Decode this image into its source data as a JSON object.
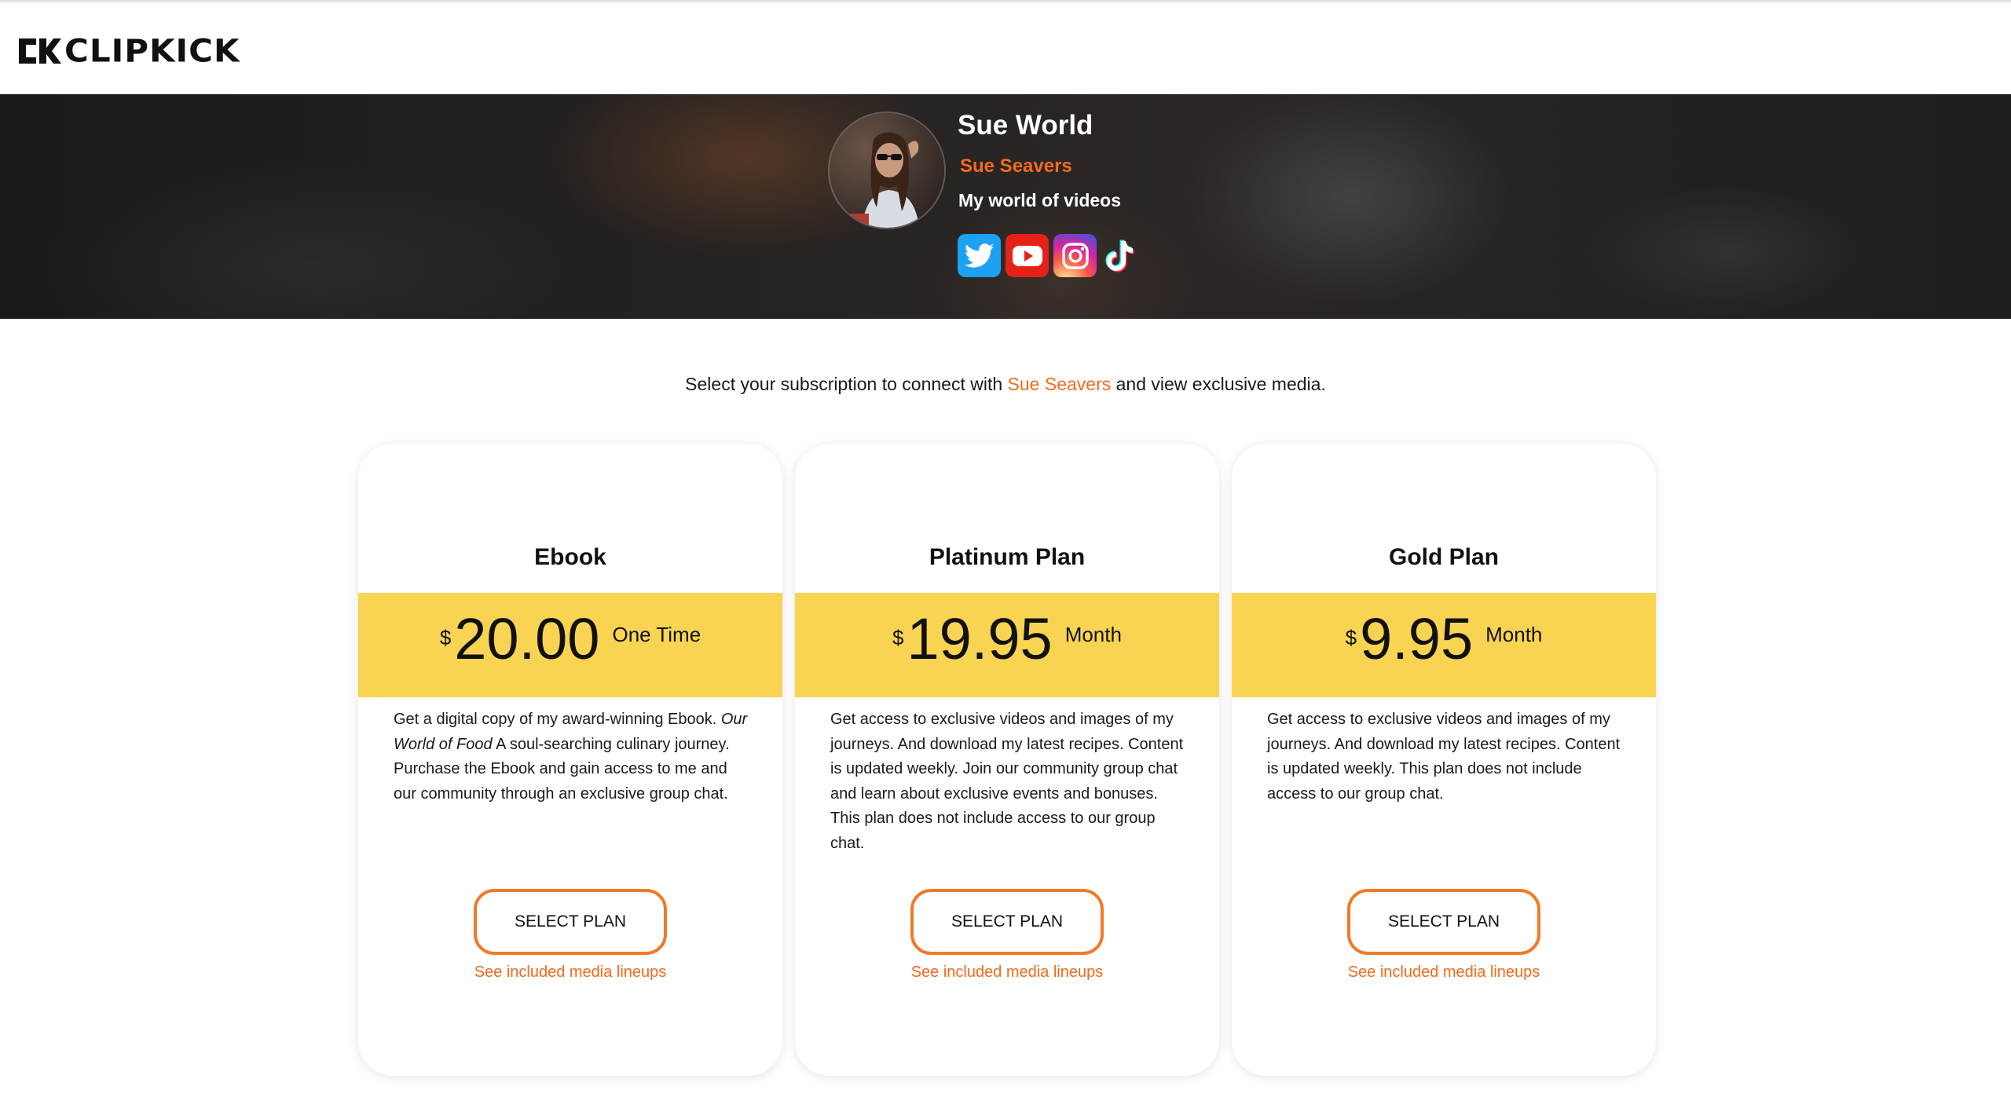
{
  "brand": {
    "logo_text": "CLIPKICK"
  },
  "creator": {
    "name": "Sue World",
    "handle": "Sue Seavers",
    "tagline": "My world of videos",
    "socials": [
      "twitter",
      "youtube",
      "instagram",
      "tiktok"
    ]
  },
  "intro": {
    "prefix": "Select your subscription to connect with ",
    "creator": "Sue Seavers",
    "suffix": " and view exclusive media."
  },
  "plans": [
    {
      "title": "Ebook",
      "currency": "$",
      "price": "20.00",
      "period": "One Time",
      "desc_part1": "Get a digital copy of my award-winning Ebook. ",
      "desc_italic": "Our World of Food",
      "desc_part2": " A soul-searching culinary journey.  Purchase the Ebook and gain access to me and our community through an exclusive group chat.",
      "button": "SELECT PLAN",
      "link": "See included media lineups"
    },
    {
      "title": "Platinum Plan",
      "currency": "$",
      "price": "19.95",
      "period": "Month",
      "desc": "Get access to exclusive videos and images of my journeys. And download my latest recipes. Content is updated weekly.  Join our community group chat and learn about exclusive events and bonuses. This plan does not include access to our group chat.",
      "button": "SELECT PLAN",
      "link": "See included media lineups"
    },
    {
      "title": "Gold Plan",
      "currency": "$",
      "price": "9.95",
      "period": "Month",
      "desc": "Get access to exclusive videos and images of my journeys. And download my latest recipes. Content is updated weekly.  This plan does not include access to our group chat.",
      "button": "SELECT PLAN",
      "link": "See included media lineups"
    }
  ],
  "colors": {
    "accent": "#f26b1d",
    "price_band": "#f8d452",
    "button_border": "#f07a2a"
  }
}
